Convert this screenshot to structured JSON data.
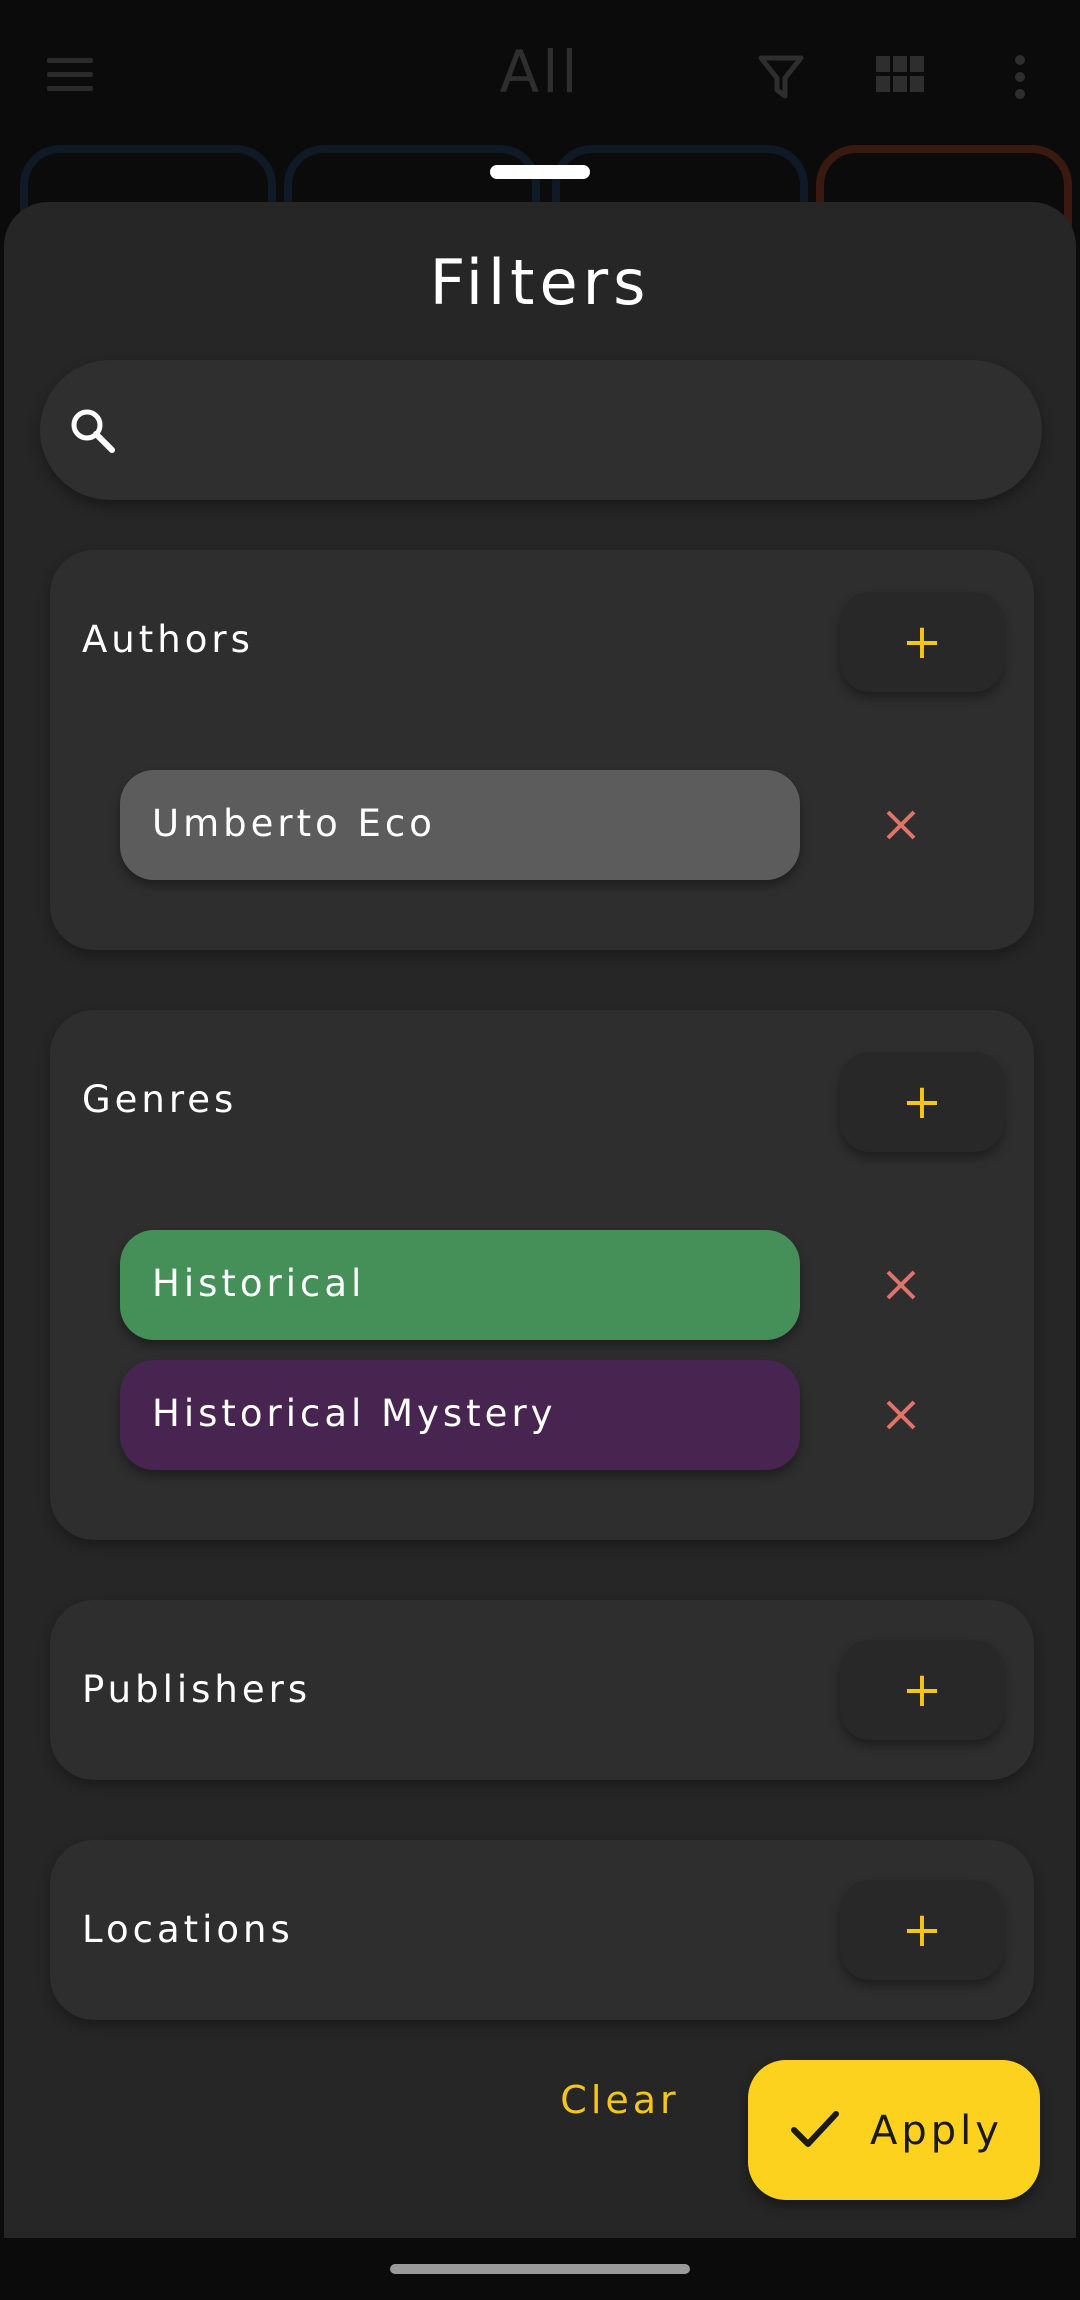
{
  "appbar": {
    "title": "All",
    "icons": [
      "menu-icon",
      "filter-icon",
      "grid-icon",
      "more-vert-icon"
    ]
  },
  "sheet": {
    "title": "Filters",
    "search": {
      "placeholder": "",
      "value": ""
    },
    "sections": {
      "authors": {
        "label": "Authors",
        "add_label": "+",
        "chips": [
          {
            "label": "Umberto Eco",
            "color": "#5c5c5c"
          }
        ]
      },
      "genres": {
        "label": "Genres",
        "add_label": "+",
        "chips": [
          {
            "label": "Historical",
            "color": "#458f58"
          },
          {
            "label": "Historical Mystery",
            "color": "#472550"
          }
        ]
      },
      "publishers": {
        "label": "Publishers",
        "add_label": "+"
      },
      "locations": {
        "label": "Locations",
        "add_label": "+"
      }
    },
    "actions": {
      "clear_label": "Clear",
      "apply_label": "Apply"
    }
  },
  "colors": {
    "accent": "#f5c518",
    "apply_bg": "#fdd21f",
    "remove": "#e0736a",
    "sheet_bg": "#262626",
    "section_bg": "#2e2e2e"
  }
}
